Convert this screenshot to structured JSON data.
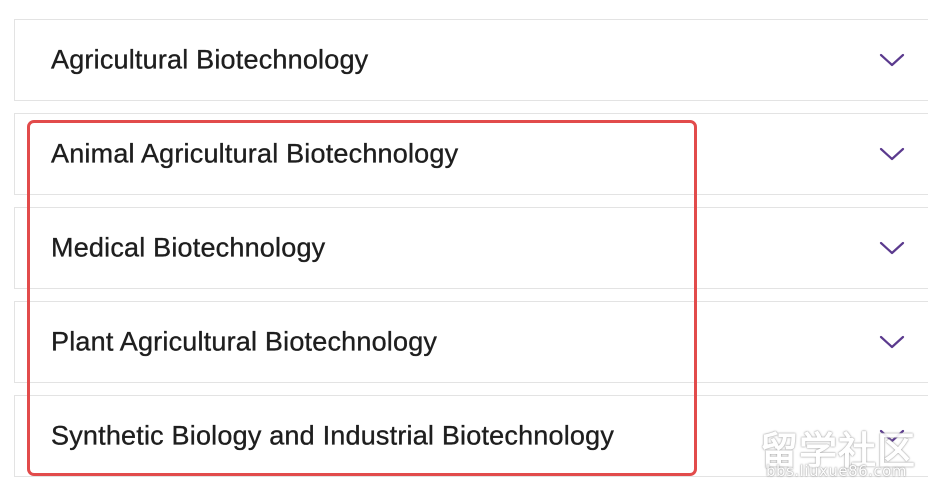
{
  "accordion": {
    "items": [
      {
        "label": "Agricultural Biotechnology",
        "icon": "chevron-down-icon",
        "expanded": false
      },
      {
        "label": "Animal Agricultural Biotechnology",
        "icon": "chevron-down-icon",
        "expanded": false
      },
      {
        "label": "Medical Biotechnology",
        "icon": "chevron-down-icon",
        "expanded": false
      },
      {
        "label": "Plant Agricultural Biotechnology",
        "icon": "chevron-down-icon",
        "expanded": false
      },
      {
        "label": "Synthetic Biology and Industrial Biotechnology",
        "icon": "chevron-down-icon",
        "expanded": false
      }
    ]
  },
  "highlight": {
    "color": "#e24b4b"
  },
  "watermark": {
    "mark": "留学社区",
    "url": "bbs.liuxue86.com"
  },
  "colors": {
    "chevron": "#5b3a8e",
    "text": "#1e1e1e",
    "border": "#e3e3e3"
  }
}
